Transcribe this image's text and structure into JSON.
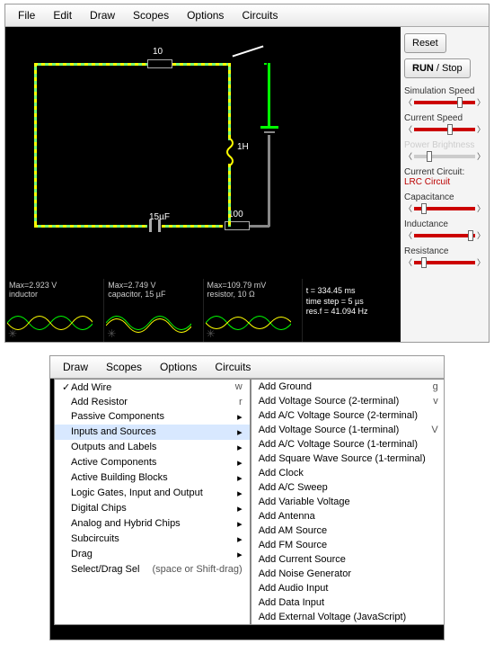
{
  "menubar": [
    "File",
    "Edit",
    "Draw",
    "Scopes",
    "Options",
    "Circuits"
  ],
  "sidebar": {
    "reset": "Reset",
    "run": "RUN / Stop",
    "sliders": [
      {
        "label": "Simulation Speed",
        "pos": 70,
        "dim": false
      },
      {
        "label": "Current Speed",
        "pos": 55,
        "dim": false
      },
      {
        "label": "Power Brightness",
        "pos": 20,
        "dim": true
      }
    ],
    "current_circuit_label": "Current Circuit:",
    "current_circuit_name": "LRC Circuit",
    "sliders2": [
      {
        "label": "Capacitance",
        "pos": 12,
        "dim": false
      },
      {
        "label": "Inductance",
        "pos": 88,
        "dim": false
      },
      {
        "label": "Resistance",
        "pos": 12,
        "dim": false
      }
    ]
  },
  "components": {
    "r1": "10",
    "c1": "15µF",
    "r2": "100",
    "l1": "1H"
  },
  "scopes": [
    {
      "l1": "Max=2.923 V",
      "l2": "inductor"
    },
    {
      "l1": "Max=2.749 V",
      "l2": "capacitor, 15 µF"
    },
    {
      "l1": "Max=109.79 mV",
      "l2": "resistor, 10 Ω"
    }
  ],
  "scope_info": [
    "t = 334.45 ms",
    "time step = 5 µs",
    "res.f = 41.094 Hz"
  ],
  "menubar2": [
    "Draw",
    "Scopes",
    "Options",
    "Circuits"
  ],
  "draw_menu": [
    {
      "t": "Add Wire",
      "k": "w",
      "chk": true
    },
    {
      "t": "Add Resistor",
      "k": "r"
    },
    {
      "t": "Passive Components",
      "sub": true
    },
    {
      "t": "Inputs and Sources",
      "sub": true,
      "sel": true
    },
    {
      "t": "Outputs and Labels",
      "sub": true
    },
    {
      "t": "Active Components",
      "sub": true
    },
    {
      "t": "Active Building Blocks",
      "sub": true
    },
    {
      "t": "Logic Gates, Input and Output",
      "sub": true
    },
    {
      "t": "Digital Chips",
      "sub": true
    },
    {
      "t": "Analog and Hybrid Chips",
      "sub": true
    },
    {
      "t": "Subcircuits",
      "sub": true
    },
    {
      "t": "Drag",
      "sub": true
    },
    {
      "t": "Select/Drag Sel",
      "k": "(space or Shift-drag)"
    }
  ],
  "sources_menu": [
    {
      "t": "Add Ground",
      "k": "g"
    },
    {
      "t": "Add Voltage Source (2-terminal)",
      "k": "v"
    },
    {
      "t": "Add A/C Voltage Source (2-terminal)"
    },
    {
      "t": "Add Voltage Source (1-terminal)",
      "k": "V"
    },
    {
      "t": "Add A/C Voltage Source (1-terminal)"
    },
    {
      "t": "Add Square Wave Source (1-terminal)"
    },
    {
      "t": "Add Clock"
    },
    {
      "t": "Add A/C Sweep"
    },
    {
      "t": "Add Variable Voltage"
    },
    {
      "t": "Add Antenna"
    },
    {
      "t": "Add AM Source"
    },
    {
      "t": "Add FM Source"
    },
    {
      "t": "Add Current Source"
    },
    {
      "t": "Add Noise Generator"
    },
    {
      "t": "Add Audio Input"
    },
    {
      "t": "Add Data Input"
    },
    {
      "t": "Add External Voltage (JavaScript)"
    }
  ],
  "comp2_c": "15µF"
}
